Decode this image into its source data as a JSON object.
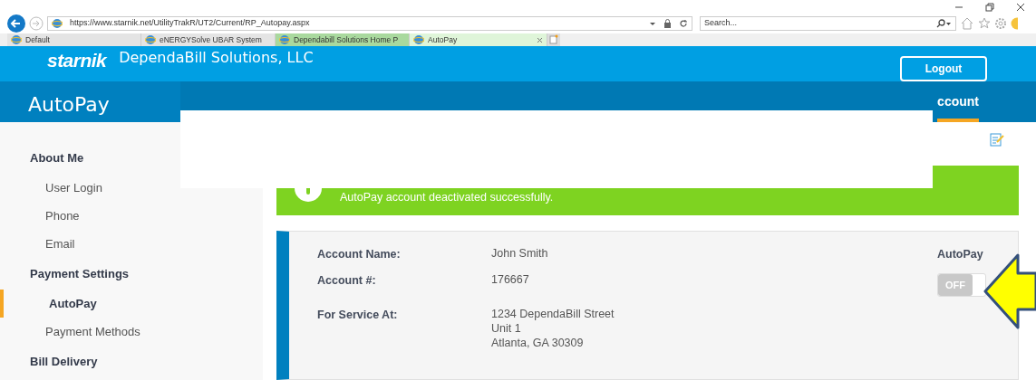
{
  "browser": {
    "url": "https://www.starnik.net/UtilityTrakR/UT2/Current/RP_Autopay.aspx",
    "search_placeholder": "Search...",
    "tabs": [
      {
        "label": "Default",
        "selected": false
      },
      {
        "label": "eNERGYSolve UBAR System",
        "selected": false
      },
      {
        "label": "Dependabill Solutions Home P",
        "selected": false
      },
      {
        "label": "AutoPay",
        "selected": true
      }
    ]
  },
  "header": {
    "logo": "starnik",
    "company": "DependaBill Solutions, LLC",
    "logout": "Logout"
  },
  "page_title": "AutoPay",
  "nav_tab": {
    "label": "ccount",
    "selected": true
  },
  "sidebar": [
    {
      "heading": "About Me",
      "items": [
        {
          "label": "User Login",
          "selected": false
        },
        {
          "label": "Phone",
          "selected": false
        },
        {
          "label": "Email",
          "selected": false
        }
      ]
    },
    {
      "heading": "Payment Settings",
      "items": [
        {
          "label": "AutoPay",
          "selected": true
        },
        {
          "label": "Payment Methods",
          "selected": false
        }
      ]
    },
    {
      "heading": "Bill Delivery"
    }
  ],
  "alert": {
    "message": "AutoPay account deactivated successfully."
  },
  "account": {
    "fields": [
      {
        "label": "Account Name:",
        "lines": [
          "John Smith"
        ]
      },
      {
        "label": "Account #:",
        "lines": [
          "176667"
        ]
      },
      {
        "label": "For Service At:",
        "lines": [
          "1234 DependaBill Street",
          "Unit 1",
          "Atlanta, GA 30309"
        ]
      }
    ],
    "autopay": {
      "label": "AutoPay",
      "state_text": "OFF",
      "on": false
    }
  }
}
